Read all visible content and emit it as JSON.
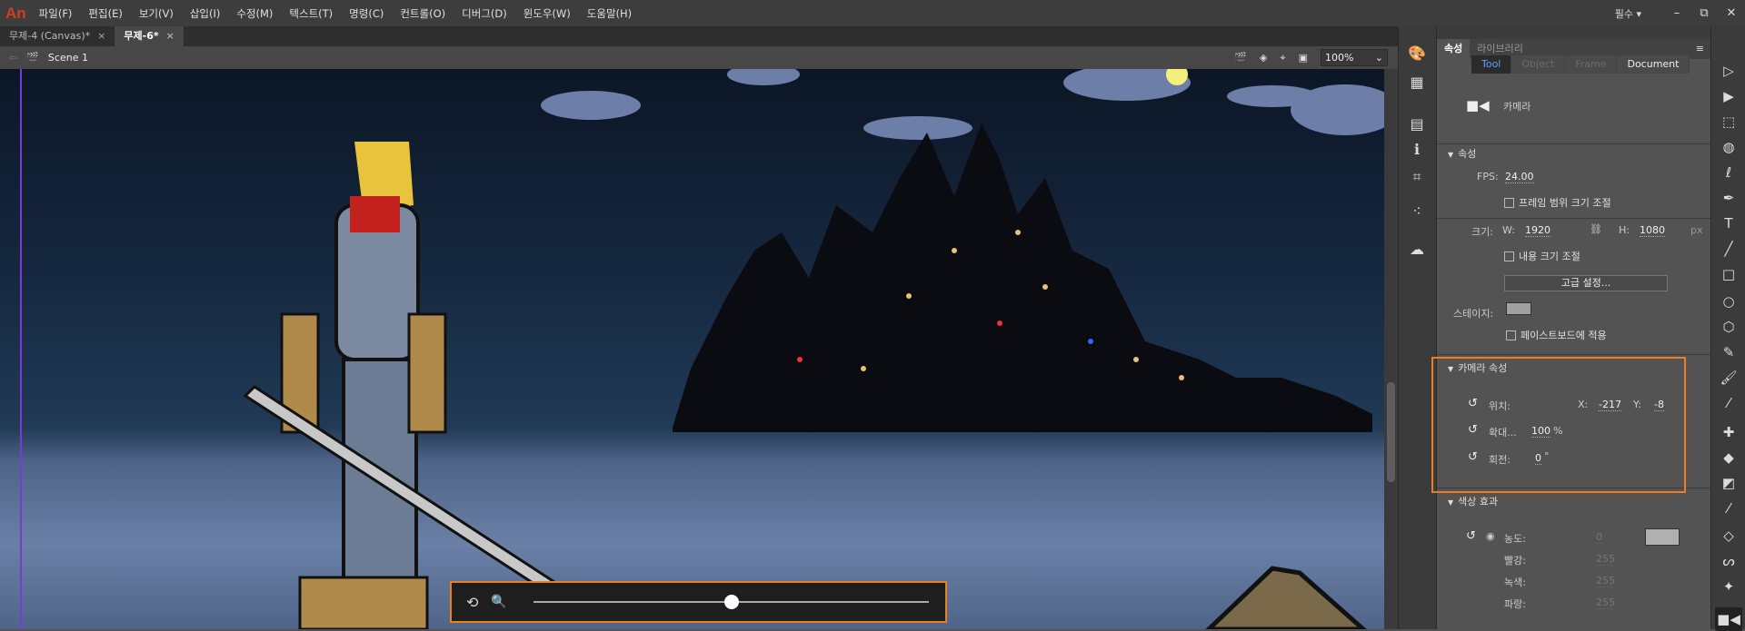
{
  "app": {
    "logo": "An",
    "workspace": "필수 ▾",
    "minimize": "–",
    "restore": "⧉",
    "close": "✕"
  },
  "menu": [
    "파일(F)",
    "편집(E)",
    "보기(V)",
    "삽입(I)",
    "수정(M)",
    "텍스트(T)",
    "명령(C)",
    "컨트롤(O)",
    "디버그(D)",
    "윈도우(W)",
    "도움말(H)"
  ],
  "tabs": [
    {
      "label": "무제-4 (Canvas)*",
      "close": "×"
    },
    {
      "label": "무제-6*",
      "close": "×"
    }
  ],
  "scene": {
    "label": "Scene 1",
    "zoom": "100%"
  },
  "panel": {
    "tabs": [
      "속성",
      "라이브러리"
    ],
    "modes": [
      "Tool",
      "Object",
      "Frame",
      "Document"
    ],
    "tool_name": "카메라",
    "props": {
      "header": "속성",
      "fps_label": "FPS:",
      "fps": "24.00",
      "scale_frames": "프레임 범위 크기 조절",
      "size_label": "크기:",
      "w_label": "W:",
      "w": "1920",
      "h_label": "H:",
      "h": "1080",
      "unit": "px",
      "scale_content": "내용 크기 조절",
      "advanced": "고급 설정...",
      "stage_label": "스테이지:",
      "apply_pasteboard": "페이스트보드에 적용",
      "stage_color": "#a0a0a0"
    },
    "camera": {
      "header": "카메라 속성",
      "pos_label": "위치:",
      "x_label": "X:",
      "x": "-217",
      "y_label": "Y:",
      "y": "-8",
      "zoom_label": "확대...",
      "zoom": "100",
      "zoom_unit": "%",
      "rot_label": "회전:",
      "rot": "0",
      "rot_unit": "°"
    },
    "color": {
      "header": "색상 효과",
      "alpha_label": "농도:",
      "alpha": "0",
      "red_label": "빨강:",
      "red": "255",
      "green_label": "녹색:",
      "green": "255",
      "blue_label": "파랑:",
      "blue": "255",
      "swatch": "#b0b0b0"
    }
  },
  "camera_slider": {
    "value": 0.5
  },
  "accent": "#f07c22"
}
